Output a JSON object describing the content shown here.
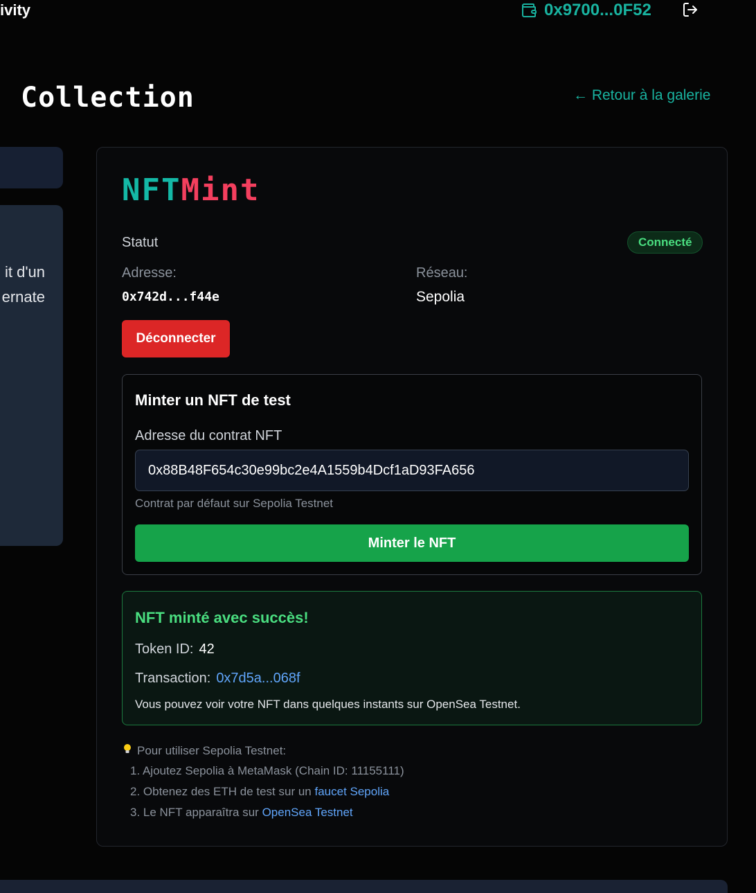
{
  "topbar": {
    "nav_fragment": "ivity",
    "wallet_address": "0x9700...0F52",
    "wallet_icon": "wallet-icon",
    "logout_icon": "logout-icon"
  },
  "page": {
    "title": "Collection",
    "back_link": "← Retour à la galerie"
  },
  "left_panel": {
    "text_line_1": "it d'un",
    "text_line_2": "ernate"
  },
  "card": {
    "logo_part_1": "NFT",
    "logo_part_2": "Mint",
    "status_label": "Statut",
    "status_badge": "Connecté",
    "address_label": "Adresse:",
    "address_value": "0x742d...f44e",
    "network_label": "Réseau:",
    "network_value": "Sepolia",
    "disconnect_label": "Déconnecter"
  },
  "mint": {
    "title": "Minter un NFT de test",
    "contract_label": "Adresse du contrat NFT",
    "contract_value": "0x88B48F654c30e99bc2e4A1559b4Dcf1aD93FA656",
    "hint": "Contrat par défaut sur Sepolia Testnet",
    "button_label": "Minter le NFT"
  },
  "success": {
    "title": "NFT minté avec succès!",
    "token_label": "Token ID:",
    "token_value": "42",
    "tx_label": "Transaction:",
    "tx_value": "0x7d5a...068f",
    "note": "Vous pouvez voir votre NFT dans quelques instants sur OpenSea Testnet."
  },
  "tips": {
    "icon": "lightbulb-icon",
    "intro": "Pour utiliser Sepolia Testnet:",
    "step1": "1. Ajoutez Sepolia à MetaMask (Chain ID: 11155111)",
    "step2_text": "2. Obtenez des ETH de test sur un ",
    "step2_link": "faucet Sepolia",
    "step3_text": "3. Le NFT apparaîtra sur ",
    "step3_link": "OpenSea Testnet"
  },
  "colors": {
    "accent_teal": "#14b8a6",
    "accent_pink": "#f43f5e",
    "success_green": "#4ade80",
    "danger_red": "#dc2626",
    "button_green": "#16a34a",
    "link_blue": "#60a5fa"
  }
}
